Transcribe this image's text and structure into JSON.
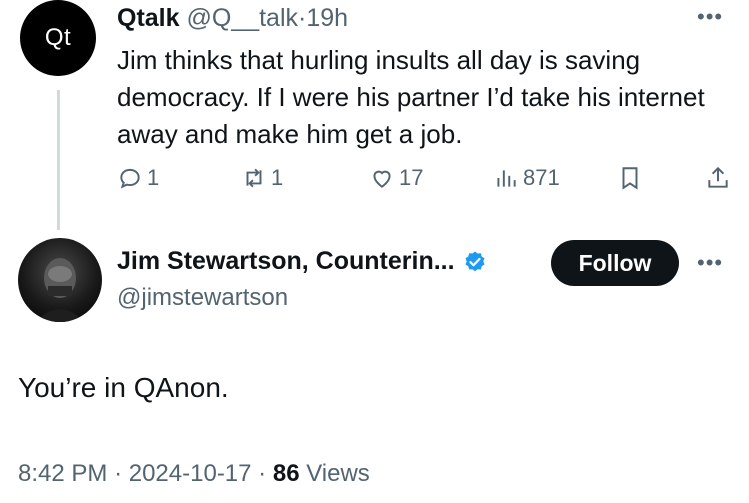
{
  "quoted_tweet": {
    "avatar_text": "Qt",
    "name": "Qtalk",
    "handle": "@Q__talk",
    "separator": "·",
    "time": "19h",
    "more_icon": "more-horizontal-icon",
    "text": "Jim thinks that hurling insults all day is saving democracy. If I were his partner I’d take his internet away and make him get a job.",
    "actions": {
      "replies": "1",
      "reposts": "1",
      "likes": "17",
      "views": "871"
    }
  },
  "reply_tweet": {
    "name": "Jim Stewartson, Counterin...",
    "verified_icon": "verified-badge-icon",
    "handle": "@jimstewartson",
    "follow_label": "Follow",
    "text": "You’re in QAnon.",
    "time": "8:42 PM",
    "separator": "·",
    "date": "2024-10-17",
    "separator2": "·",
    "views_count": "86",
    "views_label": "Views"
  },
  "colors": {
    "text_primary": "#0f1419",
    "text_secondary": "#536471",
    "verified_blue": "#1d9bf0",
    "follow_bg": "#0f1419"
  }
}
